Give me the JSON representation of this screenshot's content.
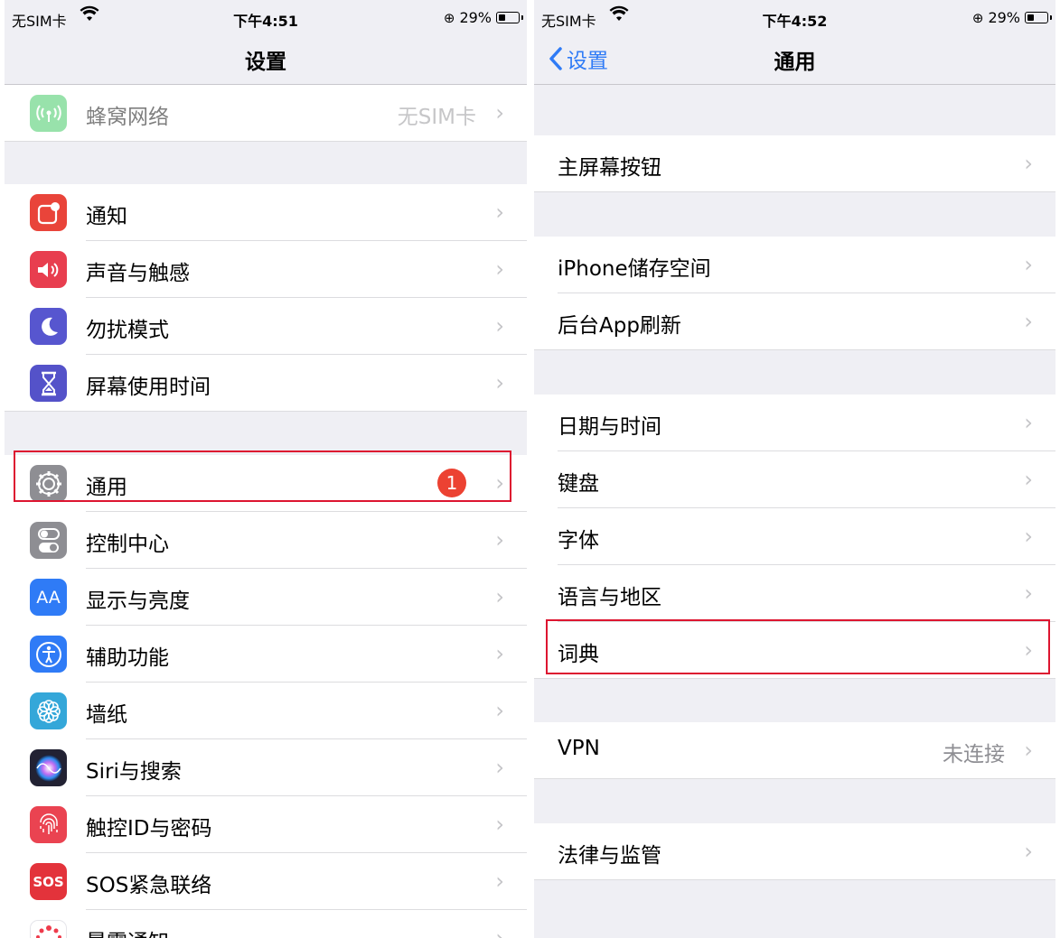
{
  "left": {
    "status": {
      "carrier": "无SIM卡",
      "time": "下午4:51",
      "battery": "29%"
    },
    "title": "设置",
    "rows": [
      {
        "label": "蜂窝网络",
        "value": "无SIM卡",
        "icon": "antenna-icon",
        "color": "#34c759"
      },
      {
        "label": "通知",
        "icon": "notifications-icon",
        "color": "#e9443a"
      },
      {
        "label": "声音与触感",
        "icon": "speaker-icon",
        "color": "#e83e4f"
      },
      {
        "label": "勿扰模式",
        "icon": "moon-icon",
        "color": "#5756cf"
      },
      {
        "label": "屏幕使用时间",
        "icon": "hourglass-icon",
        "color": "#5452c9"
      },
      {
        "label": "通用",
        "badge": "1",
        "icon": "gear-icon",
        "color": "#8e8e93"
      },
      {
        "label": "控制中心",
        "icon": "toggles-icon",
        "color": "#8e8e93"
      },
      {
        "label": "显示与亮度",
        "icon": "display-icon",
        "icon_text": "AA",
        "color": "#2f7bf6"
      },
      {
        "label": "辅助功能",
        "icon": "accessibility-icon",
        "color": "#2f7bf6"
      },
      {
        "label": "墙纸",
        "icon": "flower-icon",
        "color": "#34a7d9"
      },
      {
        "label": "Siri与搜索",
        "icon": "siri-icon",
        "color": "#222233"
      },
      {
        "label": "触控ID与密码",
        "icon": "fingerprint-icon",
        "color": "#ea4351"
      },
      {
        "label": "SOS紧急联络",
        "icon": "sos-icon",
        "icon_text": "SOS",
        "color": "#e3333b"
      },
      {
        "label": "暴露通知",
        "icon": "exposure-icon",
        "color": "#ffffff"
      }
    ]
  },
  "right": {
    "status": {
      "carrier": "无SIM卡",
      "time": "下午4:52",
      "battery": "29%"
    },
    "back_label": "设置",
    "title": "通用",
    "rows": [
      {
        "label": "主屏幕按钮"
      },
      {
        "label": "iPhone储存空间"
      },
      {
        "label": "后台App刷新"
      },
      {
        "label": "日期与时间"
      },
      {
        "label": "键盘"
      },
      {
        "label": "字体"
      },
      {
        "label": "语言与地区"
      },
      {
        "label": "词典"
      },
      {
        "label": "VPN",
        "value": "未连接"
      },
      {
        "label": "法律与监管"
      }
    ]
  },
  "chevron": "›"
}
